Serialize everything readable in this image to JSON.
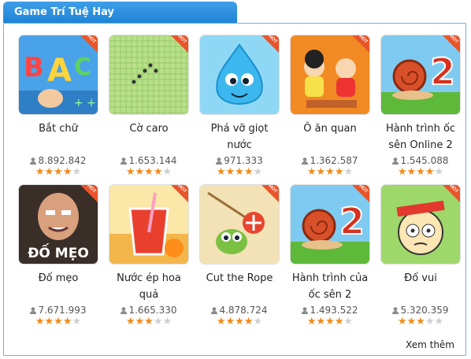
{
  "section": {
    "title": "Game Trí Tuệ Hay",
    "more_label": "Xem thêm"
  },
  "hot_label": "HOT",
  "colors": {
    "accent": "#2a8fe0",
    "star": "#f08a1c",
    "border": "#6cb2e4"
  },
  "games": [
    {
      "title": "Bắt chữ",
      "plays": "8.892.842",
      "rating": 4,
      "hot": true,
      "icon": "letters-icon"
    },
    {
      "title": "Cờ caro",
      "plays": "1.653.144",
      "rating": 4,
      "hot": true,
      "icon": "caro-board-icon"
    },
    {
      "title": "Phá vỡ giọt nước",
      "plays": "971.333",
      "rating": 4,
      "hot": true,
      "icon": "water-drop-icon"
    },
    {
      "title": "Ô ăn quan",
      "plays": "1.362.587",
      "rating": 4,
      "hot": true,
      "icon": "kids-game-icon"
    },
    {
      "title": "Hành trình ốc sên Online 2",
      "plays": "1.545.088",
      "rating": 4,
      "hot": true,
      "icon": "snail-icon"
    },
    {
      "title": "Đố mẹo",
      "plays": "7.671.993",
      "rating": 4,
      "hot": true,
      "icon": "riddle-face-icon",
      "thumb_text": "ĐỐ MẸO"
    },
    {
      "title": "Nước ép hoa quả",
      "plays": "1.665.330",
      "rating": 3,
      "hot": true,
      "icon": "juice-icon"
    },
    {
      "title": "Cut the Rope",
      "plays": "4.878.724",
      "rating": 4,
      "hot": true,
      "icon": "cut-rope-icon"
    },
    {
      "title": "Hành trình của ốc sên 2",
      "plays": "1.493.522",
      "rating": 4,
      "hot": true,
      "icon": "snail-icon"
    },
    {
      "title": "Đố vui",
      "plays": "5.320.359",
      "rating": 3,
      "hot": true,
      "icon": "cartoon-boy-icon"
    }
  ]
}
